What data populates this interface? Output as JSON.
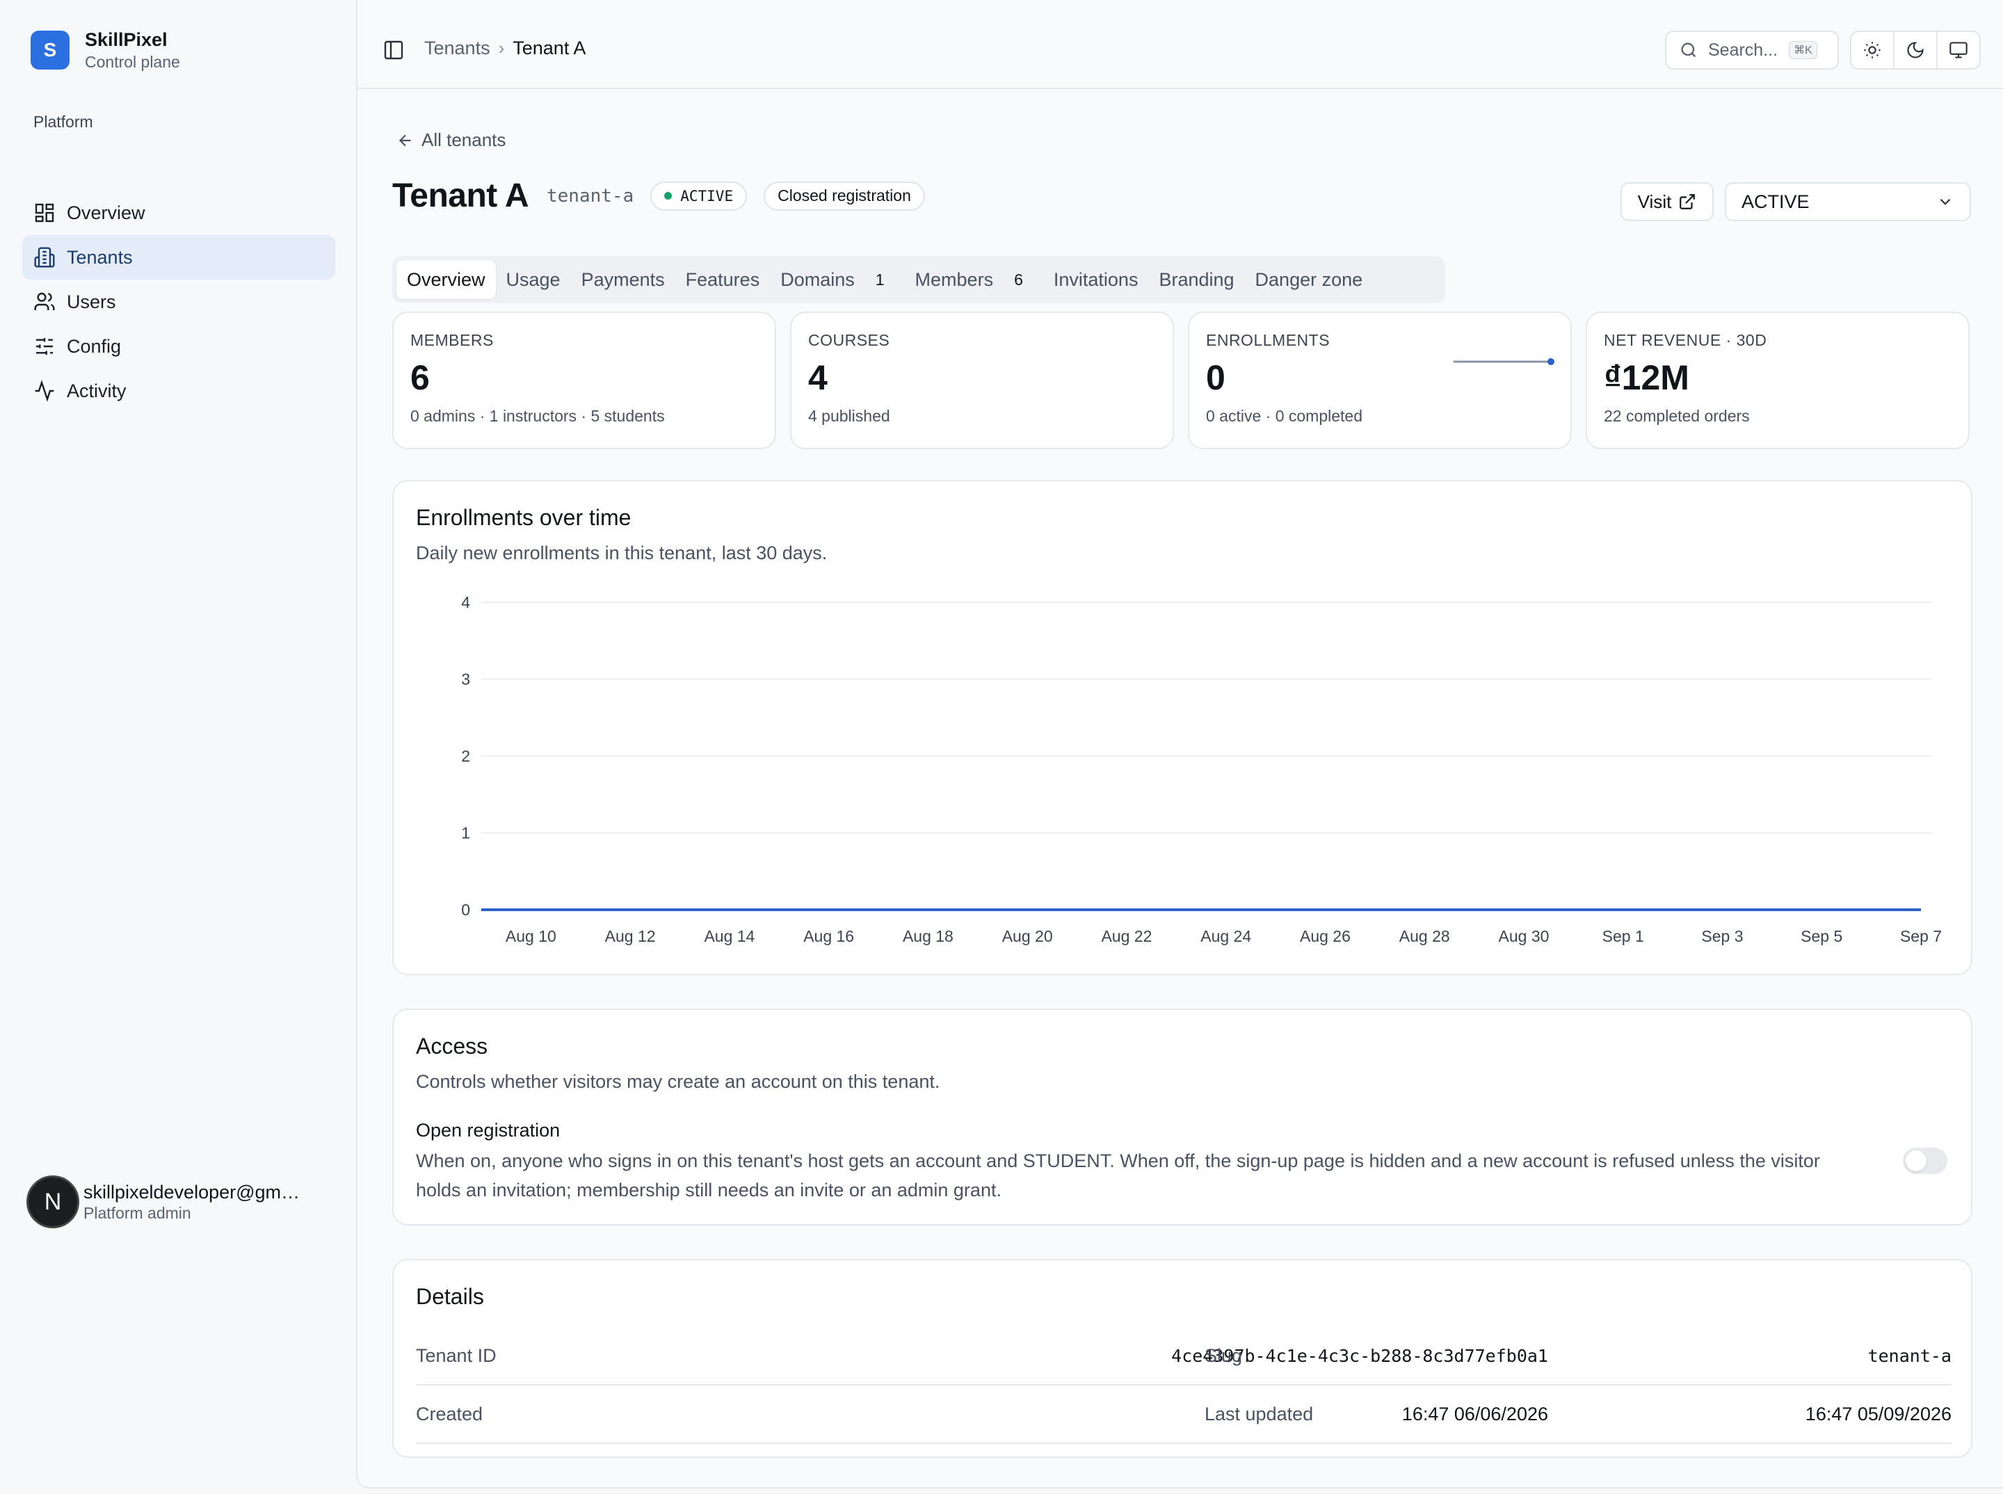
{
  "brand": {
    "logo_letter": "S",
    "name": "SkillPixel",
    "subtitle": "Control plane"
  },
  "sidebar": {
    "section": "Platform",
    "items": [
      {
        "label": "Overview",
        "icon": "layout-dashboard-icon",
        "active": false
      },
      {
        "label": "Tenants",
        "icon": "building-icon",
        "active": true
      },
      {
        "label": "Users",
        "icon": "users-icon",
        "active": false
      },
      {
        "label": "Config",
        "icon": "sliders-icon",
        "active": false
      },
      {
        "label": "Activity",
        "icon": "activity-icon",
        "active": false
      }
    ],
    "user": {
      "avatar_letter": "N",
      "email": "skillpixeldeveloper@gm…",
      "role": "Platform admin"
    }
  },
  "topbar": {
    "breadcrumb": {
      "parent": "Tenants",
      "current": "Tenant A"
    },
    "search": {
      "placeholder": "Search...",
      "shortcut": "⌘K"
    },
    "theme_buttons": [
      "sun-icon",
      "moon-icon",
      "monitor-icon"
    ]
  },
  "page": {
    "back_label": "All tenants",
    "title": "Tenant A",
    "slug": "tenant-a",
    "status_badge": "ACTIVE",
    "registration_badge": "Closed registration",
    "visit_label": "Visit",
    "status_select": "ACTIVE"
  },
  "tabs": [
    {
      "label": "Overview",
      "active": true
    },
    {
      "label": "Usage"
    },
    {
      "label": "Payments"
    },
    {
      "label": "Features"
    },
    {
      "label": "Domains",
      "count": "1"
    },
    {
      "label": "Members",
      "count": "6"
    },
    {
      "label": "Invitations"
    },
    {
      "label": "Branding"
    },
    {
      "label": "Danger zone"
    }
  ],
  "stats": [
    {
      "label": "MEMBERS",
      "value": "6",
      "sub": "0 admins · 1 instructors · 5 students"
    },
    {
      "label": "COURSES",
      "value": "4",
      "sub": "4 published"
    },
    {
      "label": "ENROLLMENTS",
      "value": "0",
      "sub": "0 active · 0 completed"
    },
    {
      "label": "NET REVENUE · 30D",
      "value": "₫12M",
      "sub": "22 completed orders"
    }
  ],
  "enrollments_chart": {
    "title": "Enrollments over time",
    "description": "Daily new enrollments in this tenant, last 30 days."
  },
  "chart_data": {
    "type": "line",
    "title": "Enrollments over time",
    "x": [
      "Aug 9",
      "Aug 10",
      "Aug 11",
      "Aug 12",
      "Aug 13",
      "Aug 14",
      "Aug 15",
      "Aug 16",
      "Aug 17",
      "Aug 18",
      "Aug 19",
      "Aug 20",
      "Aug 21",
      "Aug 22",
      "Aug 23",
      "Aug 24",
      "Aug 25",
      "Aug 26",
      "Aug 27",
      "Aug 28",
      "Aug 29",
      "Aug 30",
      "Aug 31",
      "Sep 1",
      "Sep 2",
      "Sep 3",
      "Sep 4",
      "Sep 5",
      "Sep 6",
      "Sep 7"
    ],
    "x_tick_labels": [
      "Aug 10",
      "Aug 12",
      "Aug 14",
      "Aug 16",
      "Aug 18",
      "Aug 20",
      "Aug 22",
      "Aug 24",
      "Aug 26",
      "Aug 28",
      "Aug 30",
      "Sep 1",
      "Sep 3",
      "Sep 5",
      "Sep 7"
    ],
    "y_ticks": [
      0,
      1,
      2,
      3,
      4
    ],
    "ylim": [
      0,
      4
    ],
    "grid": true,
    "series": [
      {
        "values": [
          0,
          0,
          0,
          0,
          0,
          0,
          0,
          0,
          0,
          0,
          0,
          0,
          0,
          0,
          0,
          0,
          0,
          0,
          0,
          0,
          0,
          0,
          0,
          0,
          0,
          0,
          0,
          0,
          0,
          0
        ],
        "color": "#2b63c6"
      }
    ]
  },
  "access": {
    "title": "Access",
    "description": "Controls whether visitors may create an account on this tenant.",
    "registration_title": "Open registration",
    "registration_desc": "When on, anyone who signs in on this tenant's host gets an account and STUDENT. When off, the sign-up page is hidden and a new account is refused unless the visitor holds an invitation; membership still needs an invite or an admin grant.",
    "enabled": false
  },
  "details": {
    "title": "Details",
    "tenant_id_label": "Tenant ID",
    "tenant_id": "4ce4397b-4c1e-4c3c-b288-8c3d77efb0a1",
    "slug_label": "Slug",
    "slug": "tenant-a",
    "created_label": "Created",
    "created": "16:47 06/06/2026",
    "updated_label": "Last updated",
    "updated": "16:47 05/09/2026"
  },
  "colors": {
    "accent": "#2b6fe0",
    "active_nav_bg": "#e3ecf8",
    "status_dot": "#16a36a",
    "chart_line": "#2b63c6"
  }
}
